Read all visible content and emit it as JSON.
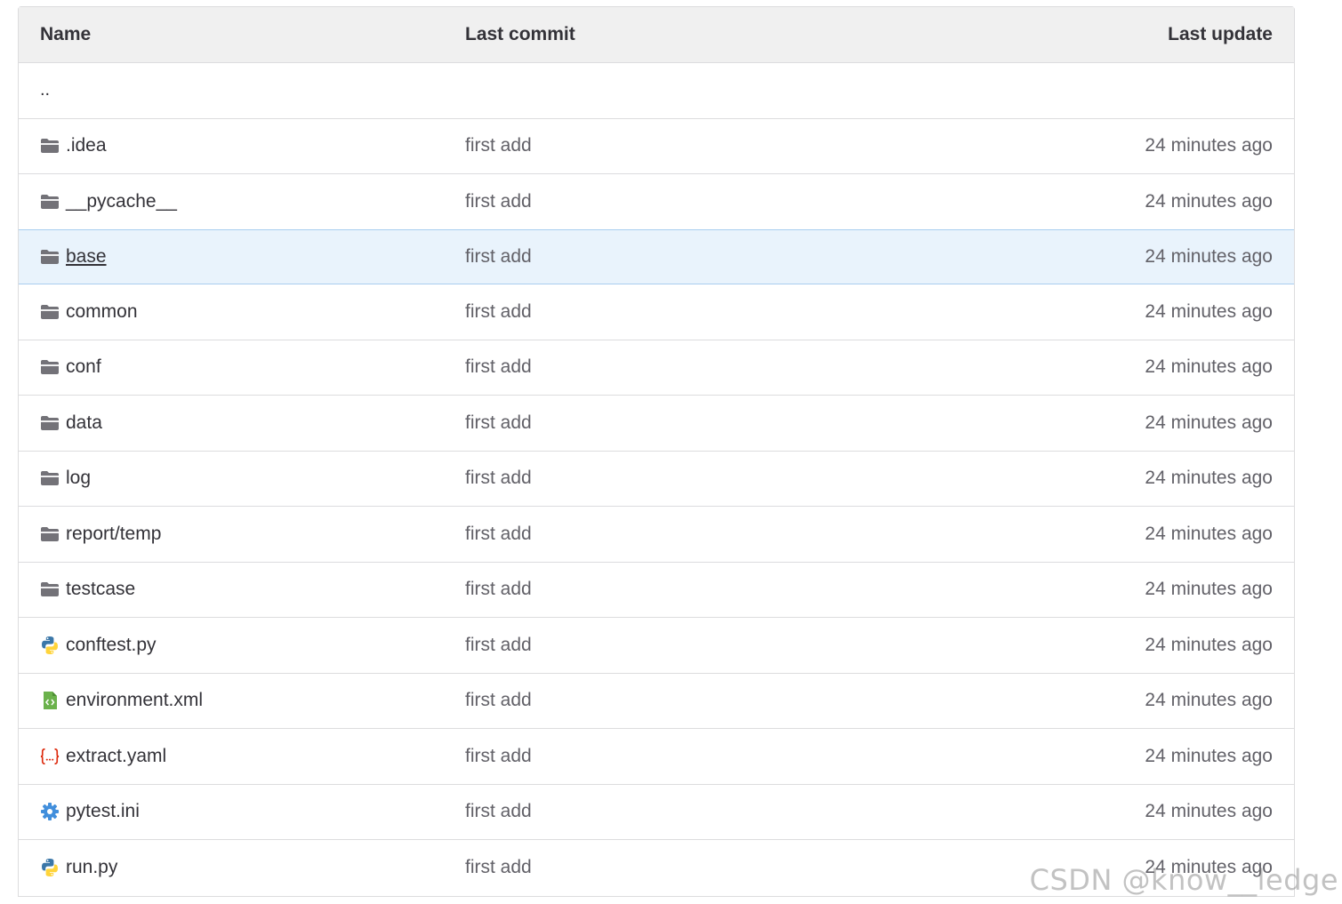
{
  "table": {
    "headers": {
      "name": "Name",
      "last_commit": "Last commit",
      "last_update": "Last update"
    },
    "parent": "..",
    "rows": [
      {
        "name": ".idea",
        "icon": "folder-icon",
        "commit": "first add",
        "updated": "24 minutes ago"
      },
      {
        "name": "__pycache__",
        "icon": "folder-icon",
        "commit": "first add",
        "updated": "24 minutes ago"
      },
      {
        "name": "base",
        "icon": "folder-icon",
        "commit": "first add",
        "updated": "24 minutes ago"
      },
      {
        "name": "common",
        "icon": "folder-icon",
        "commit": "first add",
        "updated": "24 minutes ago"
      },
      {
        "name": "conf",
        "icon": "folder-icon",
        "commit": "first add",
        "updated": "24 minutes ago"
      },
      {
        "name": "data",
        "icon": "folder-icon",
        "commit": "first add",
        "updated": "24 minutes ago"
      },
      {
        "name": "log",
        "icon": "folder-icon",
        "commit": "first add",
        "updated": "24 minutes ago"
      },
      {
        "name": "report/temp",
        "icon": "folder-icon",
        "commit": "first add",
        "updated": "24 minutes ago"
      },
      {
        "name": "testcase",
        "icon": "folder-icon",
        "commit": "first add",
        "updated": "24 minutes ago"
      },
      {
        "name": "conftest.py",
        "icon": "python-file-icon",
        "commit": "first add",
        "updated": "24 minutes ago"
      },
      {
        "name": "environment.xml",
        "icon": "xml-file-icon",
        "commit": "first add",
        "updated": "24 minutes ago"
      },
      {
        "name": "extract.yaml",
        "icon": "yaml-file-icon",
        "commit": "first add",
        "updated": "24 minutes ago"
      },
      {
        "name": "pytest.ini",
        "icon": "settings-file-icon",
        "commit": "first add",
        "updated": "24 minutes ago"
      },
      {
        "name": "run.py",
        "icon": "python-file-icon",
        "commit": "first add",
        "updated": "24 minutes ago"
      }
    ]
  },
  "watermark": "CSDN @know__ledge",
  "colors": {
    "folder": "#737278",
    "highlight_bg": "#e9f3fc",
    "yaml": "#dd2b0e",
    "xml": "#6bb24c",
    "settings": "#428fdc"
  }
}
